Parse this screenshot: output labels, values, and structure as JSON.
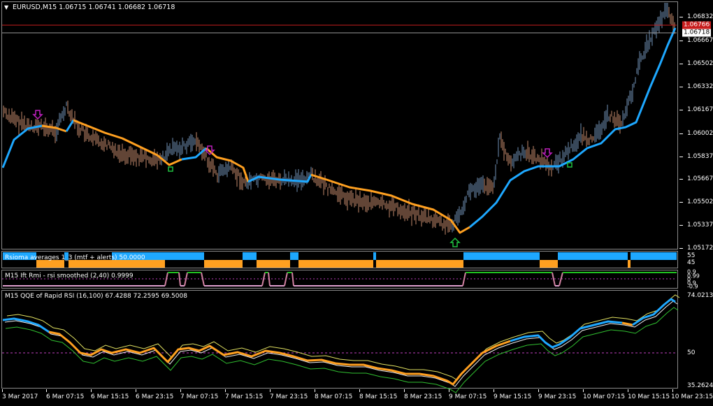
{
  "header": {
    "symbol_line": "EURUSD,M15  1.06715 1.06741 1.06682 1.06718",
    "menu_icon": "triangle-down-icon"
  },
  "price_axis": {
    "ticks": [
      "1.06832",
      "1.06667",
      "1.06502",
      "1.06332",
      "1.06167",
      "1.06002",
      "1.05837",
      "1.05667",
      "1.05502",
      "1.05337",
      "1.05172"
    ],
    "tag_red": "1.06766",
    "tag_white": "1.06718"
  },
  "indicators": {
    "rsioma": {
      "title": "Rsioma averages 1_3 (mtf + alerts) 50.0000",
      "axis_top": "55",
      "axis_bottom": "45"
    },
    "ift": {
      "title": "M15 Ift Rmi - rsi smoothed (2,40) 0.9999",
      "axis": [
        "0.9",
        "0.99",
        "0",
        "0.9",
        "-0.9"
      ]
    },
    "qqe": {
      "title": "M15 QQE of Rapid RSI (16,100) 67.4288 72.2595 69.5008",
      "axis": [
        "74.0213",
        "50",
        "35.2624"
      ]
    }
  },
  "time_axis": [
    "3 Mar 2017",
    "6 Mar 07:15",
    "6 Mar 15:15",
    "6 Mar 23:15",
    "7 Mar 07:15",
    "7 Mar 15:15",
    "7 Mar 23:15",
    "8 Mar 07:15",
    "8 Mar 15:15",
    "8 Mar 23:15",
    "9 Mar 07:15",
    "9 Mar 15:15",
    "9 Mar 23:15",
    "10 Mar 07:15",
    "10 Mar 15:15",
    "10 Mar 23:15"
  ],
  "colors": {
    "bull_bar": "#6f8fb3",
    "bear_bar": "#c48a6b",
    "ma_up": "#1ea8ff",
    "ma_down": "#ffa020",
    "arrow_down": "#c020c0",
    "arrow_up": "#20c040",
    "hline_red": "#c81e1e",
    "grid_pink": "#c040c0"
  },
  "icons": {
    "signal_down": "arrow-down-icon",
    "signal_up": "arrow-up-icon"
  }
}
